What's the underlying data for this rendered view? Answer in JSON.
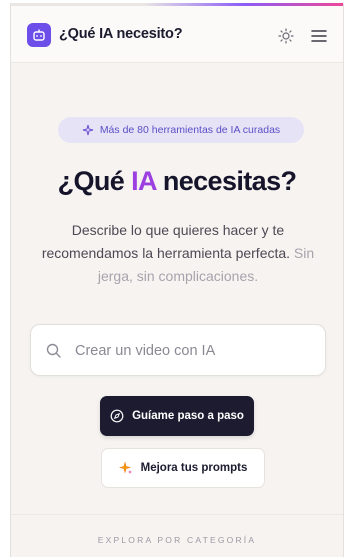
{
  "header": {
    "brand": "¿Qué IA necesito?",
    "logo_icon": "robot-icon",
    "theme_icon": "sun-icon",
    "menu_icon": "hamburger-menu-icon"
  },
  "badge": {
    "icon": "sparkles-icon",
    "text": "Más de 80 herramientas de IA curadas"
  },
  "hero": {
    "title_prefix": "¿Qué ",
    "title_accent": "IA",
    "title_suffix": " necesitas?"
  },
  "subtitle": {
    "main": "Describe lo que quieres hacer y te recomendamos la herramienta perfecta.",
    "muted": " Sin jerga, sin complicaciones."
  },
  "search": {
    "placeholder": "Crear un video con IA",
    "value": ""
  },
  "actions": {
    "guide_label": "Guíame paso a paso",
    "guide_icon": "compass-icon",
    "prompts_label": "Mejora tus prompts",
    "prompts_icon": "sparkles-icon"
  },
  "explore": {
    "label": "EXPLORA POR CATEGORÍA"
  },
  "colors": {
    "accent": "#9b3fe0",
    "brand": "#6d4ee8",
    "dark_button": "#1c1b30",
    "badge_bg": "#e6e3f6"
  }
}
